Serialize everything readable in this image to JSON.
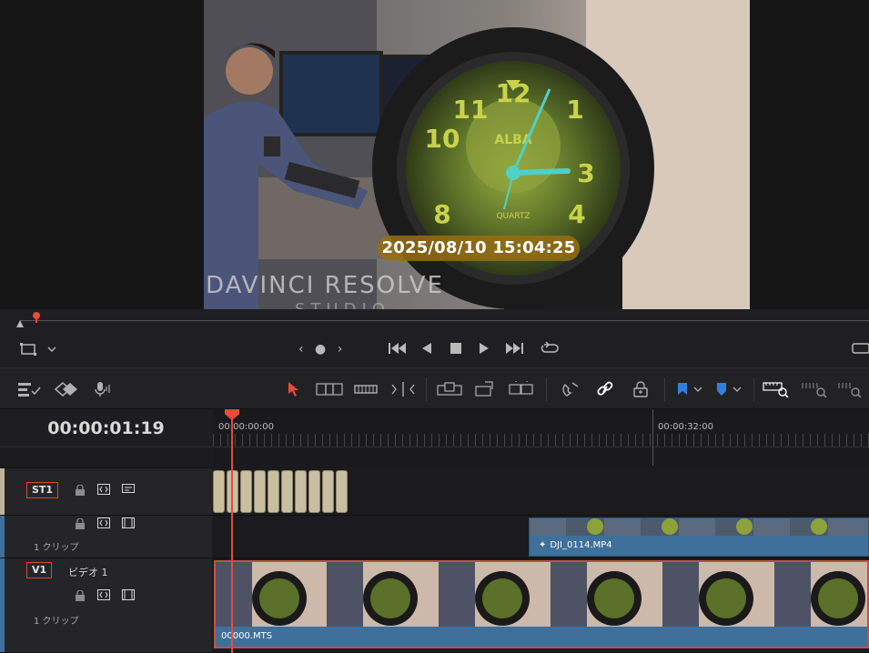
{
  "viewer": {
    "overlay_timestamp": "2025/08/10 15:04:25",
    "watermark": "DAVINCI RESOLVE",
    "watermark_sub": "STUDIO",
    "clock_brand": "ALBA",
    "clock_sub": "QUARTZ"
  },
  "transport": {
    "nav": "‹ ● ›"
  },
  "timeline": {
    "current_timecode": "00:00:01:19",
    "ruler_labels": [
      "00:00:00:00",
      "00:00:32:00"
    ]
  },
  "tracks": {
    "st1": {
      "tag": "ST1"
    },
    "v2": {
      "clip_count": "1 クリップ",
      "clip_name": "DJI_0114.MP4"
    },
    "v1": {
      "tag": "V1",
      "name": "ビデオ 1",
      "clip_count": "1 クリップ",
      "clip_name": "00000.MTS"
    }
  },
  "colors": {
    "accent_red": "#e64b3c",
    "clip_blue": "#3f6f9b",
    "subtitle_block": "#c9bea0",
    "overlay_gold": "#96701a"
  }
}
